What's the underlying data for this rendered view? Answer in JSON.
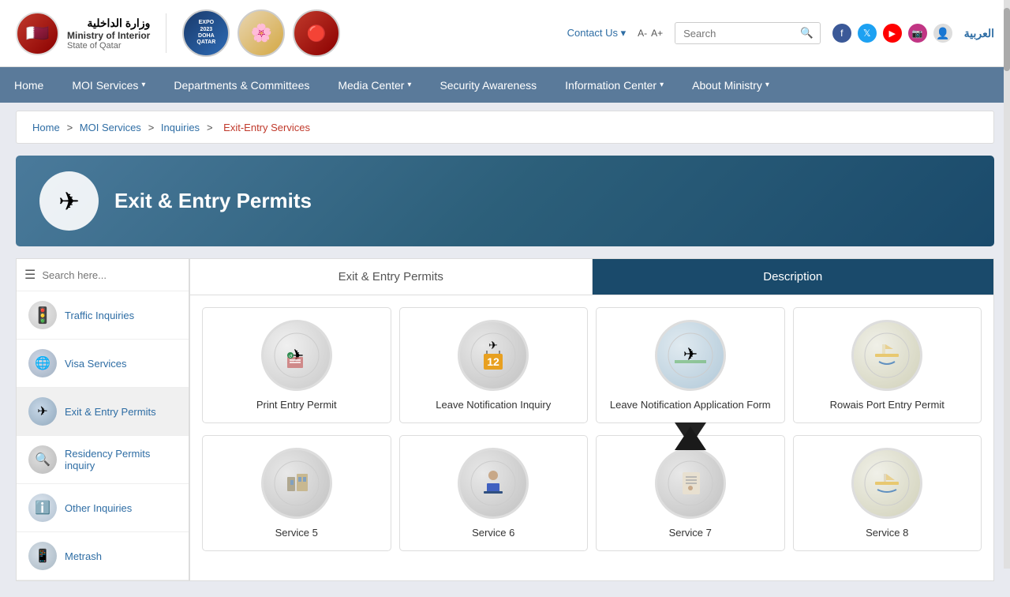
{
  "header": {
    "logo": {
      "arabic": "وزارة الداخلية",
      "english_line1": "Ministry of Interior",
      "english_line2": "State of Qatar"
    },
    "expo_label": "EXPO\n2023\nDOHA\nQATAR",
    "contact_us": "Contact Us",
    "font_smaller": "A-",
    "font_larger": "A+",
    "search_placeholder": "Search",
    "language": "العربية"
  },
  "nav": {
    "items": [
      {
        "label": "Home",
        "has_arrow": false
      },
      {
        "label": "MOI Services",
        "has_arrow": true
      },
      {
        "label": "Departments & Committees",
        "has_arrow": false
      },
      {
        "label": "Media Center",
        "has_arrow": true
      },
      {
        "label": "Security Awareness",
        "has_arrow": false
      },
      {
        "label": "Information Center",
        "has_arrow": true
      },
      {
        "label": "About Ministry",
        "has_arrow": true
      }
    ]
  },
  "breadcrumb": {
    "items": [
      "Home",
      "MOI Services",
      "Inquiries"
    ],
    "current": "Exit-Entry Services"
  },
  "banner": {
    "title": "Exit & Entry Permits"
  },
  "sidebar": {
    "search_placeholder": "Search here...",
    "items": [
      {
        "label": "Traffic Inquiries",
        "icon": "🚦"
      },
      {
        "label": "Visa Services",
        "icon": "✈"
      },
      {
        "label": "Exit & Entry Permits",
        "icon": "✈",
        "active": true
      },
      {
        "label": "Residency Permits inquiry",
        "icon": "🔍"
      },
      {
        "label": "Other Inquiries",
        "icon": "ℹ"
      },
      {
        "label": "Metrash",
        "icon": "📱"
      }
    ]
  },
  "service_area": {
    "tabs": [
      {
        "label": "Exit & Entry Permits",
        "active": false
      },
      {
        "label": "Description",
        "active": true
      }
    ],
    "cards_row1": [
      {
        "label": "Print Entry Permit",
        "icon": "✈"
      },
      {
        "label": "Leave Notification Inquiry",
        "icon": "📅"
      },
      {
        "label": "Leave Notification Application Form",
        "icon": "✈"
      },
      {
        "label": "Rowais Port Entry Permit",
        "icon": "⛵"
      }
    ],
    "cards_row2": [
      {
        "label": "Service 5",
        "icon": "🏢"
      },
      {
        "label": "Service 6",
        "icon": "📋"
      },
      {
        "label": "Service 7",
        "icon": "📄"
      },
      {
        "label": "Service 8",
        "icon": "⚓"
      }
    ]
  }
}
